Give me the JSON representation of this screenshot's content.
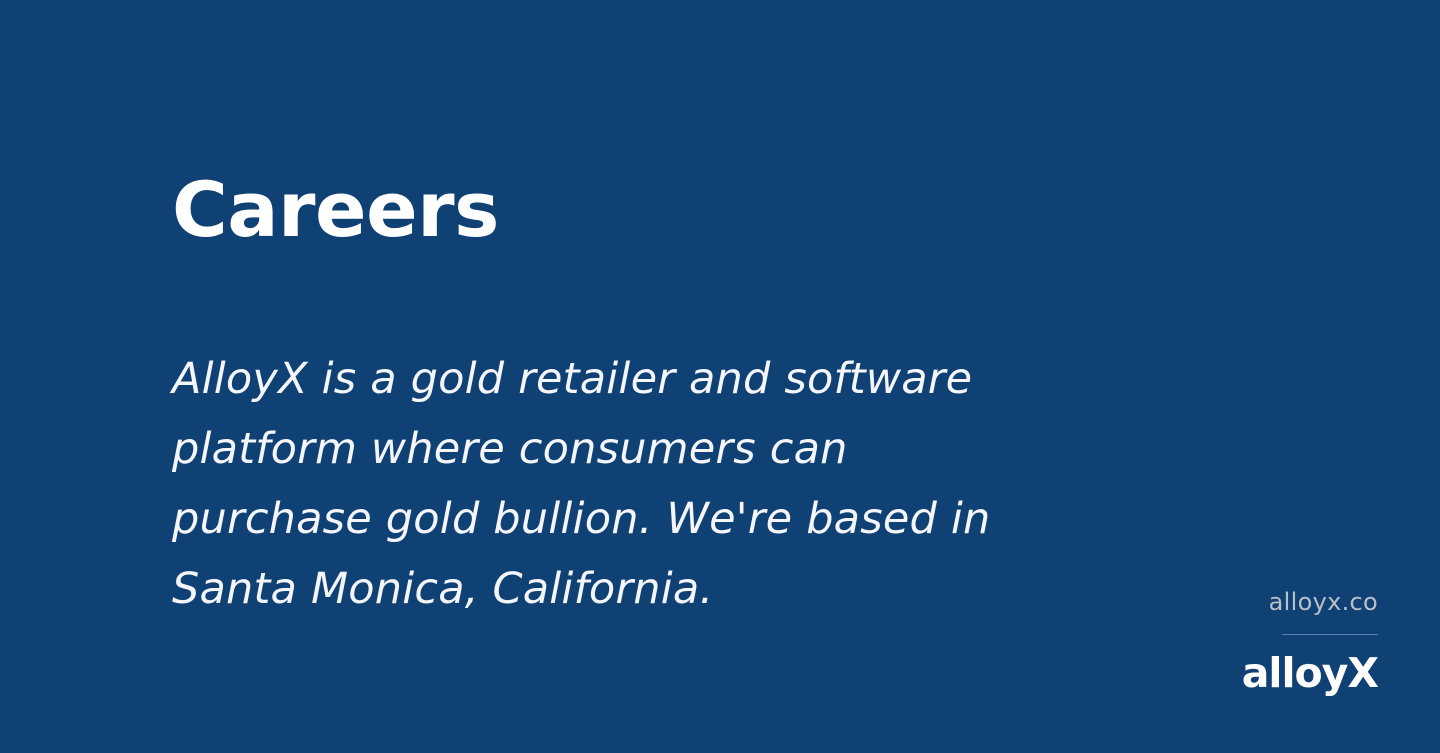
{
  "header": {
    "title": "Careers"
  },
  "main": {
    "description": "AlloyX is a gold retailer and software platform where consumers can purchase gold bullion. We're based in Santa Monica, California."
  },
  "footer": {
    "site_link": "alloyx.co",
    "logo_text": "alloyX"
  },
  "colors": {
    "background": "#0f4174",
    "title": "#ffffff",
    "description": "#f4f6fb",
    "site_link": "#b9bfc9",
    "divider": "#5f7fa8",
    "logo": "#ffffff"
  }
}
